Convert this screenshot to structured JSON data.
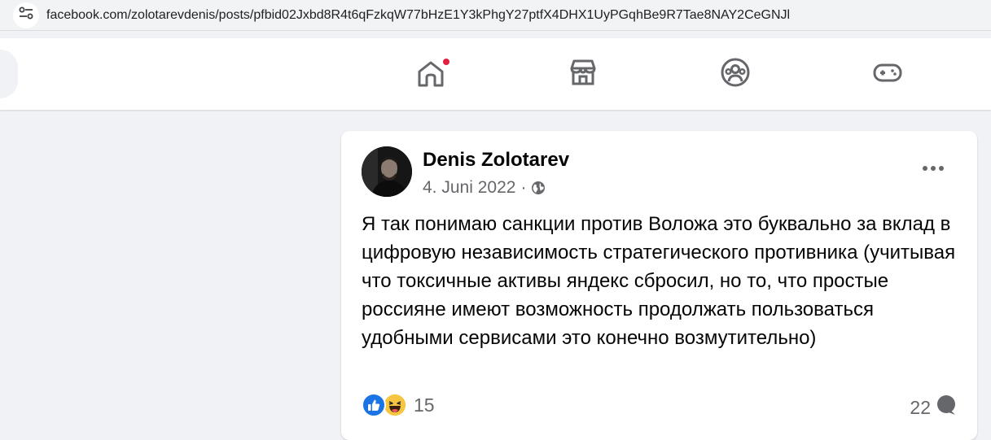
{
  "browser": {
    "url": "facebook.com/zolotarevdenis/posts/pfbid02Jxbd8R4t6qFzkqW77bHzE1Y3kPhgY27ptfX4DHX1UyPGqhBe9R7Tae8NAY2CeGNJl",
    "site_info_icon": "tune-icon"
  },
  "nav": {
    "tabs": [
      {
        "name": "home",
        "icon": "home-icon",
        "has_notification": true
      },
      {
        "name": "marketplace",
        "icon": "store-icon"
      },
      {
        "name": "groups",
        "icon": "groups-icon"
      },
      {
        "name": "gaming",
        "icon": "gamepad-icon"
      }
    ],
    "notification_color": "#e41e3f"
  },
  "post": {
    "author": "Denis Zolotarev",
    "date": "4. Juni 2022",
    "separator": "·",
    "audience_icon": "globe-icon",
    "text": "Я так понимаю санкции против Воложа это буквально за вклад в цифровую независимость стратегического противника (учитывая что токсичные активы яндекс сбросил, но то, что простые россияне имеют возможность продолжать пользоваться удобными сервисами это конечно возмутительно)",
    "reactions": {
      "types": [
        "like",
        "haha"
      ],
      "count": "15"
    },
    "comments": {
      "count": "22",
      "icon": "comment-bubble-icon"
    }
  },
  "colors": {
    "accent": "#1b74e4",
    "background": "#f0f2f5",
    "secondary_text": "#65676b"
  }
}
